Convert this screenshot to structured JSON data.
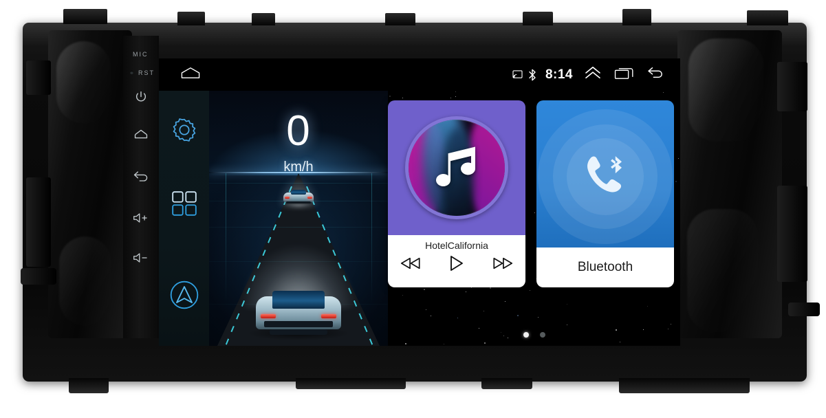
{
  "device": {
    "bezel_labels": {
      "mic": "MIC",
      "reset": "RST"
    },
    "hardware_buttons": [
      {
        "name": "power-button",
        "icon": "power-icon"
      },
      {
        "name": "home-button",
        "icon": "home-icon"
      },
      {
        "name": "back-button",
        "icon": "back-arrow-icon"
      },
      {
        "name": "volume-up-button",
        "icon": "volume-up-icon"
      },
      {
        "name": "volume-down-button",
        "icon": "volume-down-icon"
      }
    ]
  },
  "status_bar": {
    "home_icon": "home-icon",
    "cast_icon": "screen-cast-icon",
    "bluetooth_icon": "bluetooth-icon",
    "time": "8:14",
    "expand_icon": "double-chevron-up-icon",
    "recents_icon": "recent-apps-icon",
    "back_icon": "back-arrow-icon"
  },
  "sidebar": {
    "items": [
      {
        "label": "Settings",
        "icon": "gear-icon"
      },
      {
        "label": "All Apps",
        "icon": "apps-grid-icon"
      },
      {
        "label": "Navigation",
        "icon": "navigation-arrow-icon"
      }
    ]
  },
  "speed_widget": {
    "value": "0",
    "unit": "km/h"
  },
  "music_widget": {
    "track_title": "HotelCalifornia",
    "album_art_icon": "music-note-icon",
    "controls": [
      {
        "label": "Previous",
        "icon": "previous-track-icon"
      },
      {
        "label": "Play",
        "icon": "play-icon"
      },
      {
        "label": "Next",
        "icon": "next-track-icon"
      }
    ]
  },
  "bluetooth_widget": {
    "label": "Bluetooth",
    "icon": "bluetooth-phone-icon"
  },
  "pagination": {
    "pages": 2,
    "active_index": 0
  },
  "colors": {
    "music_purple": "#6f60cb",
    "album_ring": "#8275d6",
    "bluetooth_blue": "#2f87da",
    "accent_cyan": "#3cd2e1",
    "sidebar_icon_blue": "#2f9fe0",
    "screen_black": "#000000",
    "card_white": "#ffffff"
  }
}
